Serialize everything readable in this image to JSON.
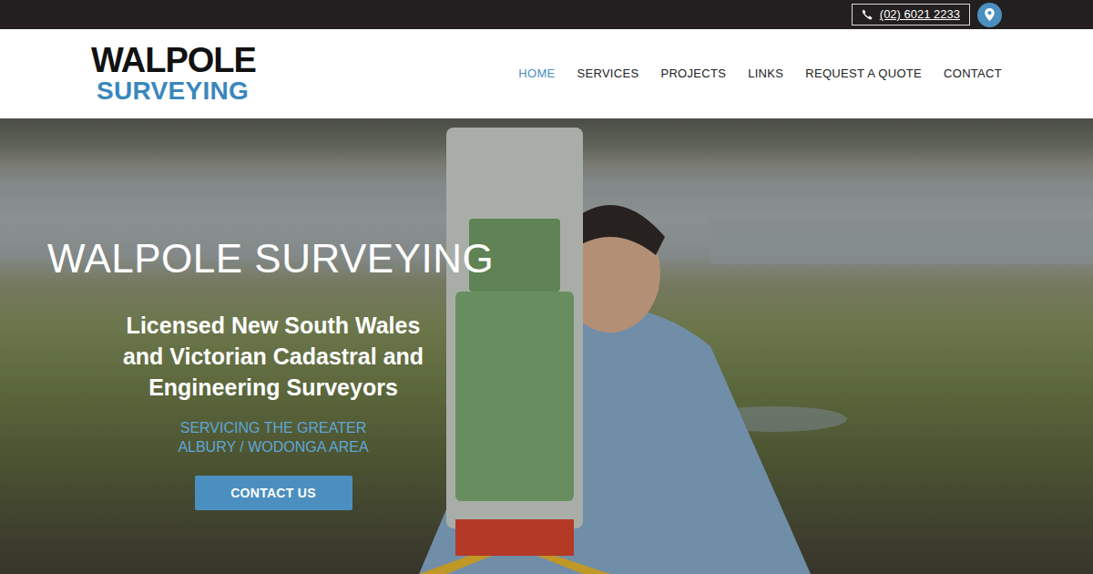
{
  "topbar": {
    "phone": "(02) 6021 2233"
  },
  "logo": {
    "line1": "WALPOLE",
    "line2": "SURVEYING"
  },
  "nav": [
    {
      "label": "HOME",
      "selected": true
    },
    {
      "label": "SERVICES",
      "selected": false
    },
    {
      "label": "PROJECTS",
      "selected": false
    },
    {
      "label": "LINKS",
      "selected": false
    },
    {
      "label": "REQUEST A QUOTE",
      "selected": false
    },
    {
      "label": "CONTACT",
      "selected": false
    }
  ],
  "hero": {
    "title": "WALPOLE SURVEYING",
    "subtitle_lines": [
      "Licensed New South Wales",
      "and Victorian Cadastral and",
      "Engineering Surveyors"
    ],
    "tagline_lines": [
      "SERVICING THE GREATER",
      "ALBURY / WODONGA AREA"
    ],
    "button": "CONTACT US"
  }
}
